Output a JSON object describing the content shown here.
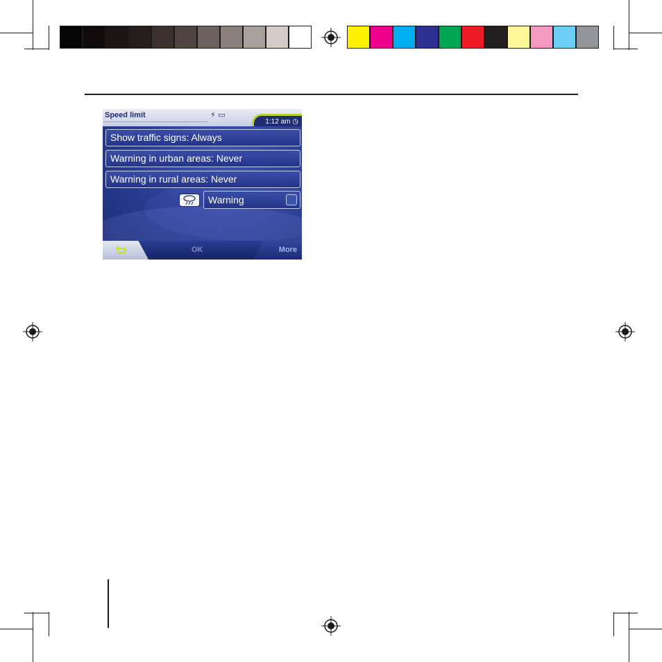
{
  "print_marks": {
    "swatches_left": [
      "#050505",
      "#0f0b0b",
      "#1b1515",
      "#261e1c",
      "#3b302d",
      "#4f4442",
      "#6d625f",
      "#8b807b",
      "#a8a09c",
      "#d4cbc8",
      "#ffffff"
    ],
    "swatches_right": [
      "#fff200",
      "#ec008c",
      "#00aeef",
      "#2e3192",
      "#00a651",
      "#ed1c24",
      "#231f20",
      "#fff799",
      "#f49ac1",
      "#6dcff6",
      "#939598"
    ]
  },
  "screen": {
    "title": "Speed limit",
    "status_icons": "⚡ ▭",
    "clock": "1:12 am",
    "menu_items": [
      {
        "label": "Show traffic signs: Always"
      },
      {
        "label": "Warning in urban areas: Never"
      },
      {
        "label": "Warning in rural areas: Never"
      }
    ],
    "warning_label": "Warning",
    "footer": {
      "ok": "OK",
      "more": "More"
    },
    "colors": {
      "accent": "#b9d22c",
      "panel": "#2c3f96",
      "header": "#1f2d6e"
    }
  }
}
